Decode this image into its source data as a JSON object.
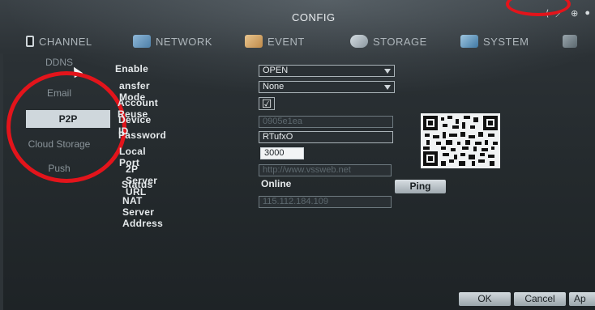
{
  "window": {
    "title": "CONFIG"
  },
  "tabs": [
    {
      "label": "CHANNEL"
    },
    {
      "label": "NETWORK"
    },
    {
      "label": "EVENT"
    },
    {
      "label": "STORAGE"
    },
    {
      "label": "SYSTEM"
    }
  ],
  "sidebar": {
    "items": [
      {
        "label": "DDNS"
      },
      {
        "label": "Email"
      },
      {
        "label": "P2P"
      },
      {
        "label": "Cloud Storage"
      },
      {
        "label": "Push"
      }
    ]
  },
  "form": {
    "enable_label": "Enable",
    "enable_value": "OPEN",
    "transfer_mode_label": "ansfer Mode",
    "transfer_mode_value": "None",
    "account_reuse_label": "Account Reuse",
    "account_reuse_checked": "☑",
    "device_id_label": "Device ID",
    "device_id_value": "0905e1ea",
    "password_label": "Password",
    "password_value": "RTufxO",
    "local_port_label": "Local Port",
    "local_port_value": "3000",
    "p2p_server_url_label": "2P Server URL",
    "p2p_server_url_value": "http://www.vssweb.net",
    "status_label": "Status",
    "status_value": "Online",
    "ping_label": "Ping",
    "nat_server_address_label": "NAT Server Address",
    "nat_server_address_value": "115.112.184.109"
  },
  "footer": {
    "ok_label": "OK",
    "cancel_label": "Cancel",
    "apply_label": "Ap"
  },
  "colors": {
    "annotation_red": "#e3141b",
    "panel_bg": "#242a2d",
    "selected_item_bg": "#cfd7dc"
  }
}
